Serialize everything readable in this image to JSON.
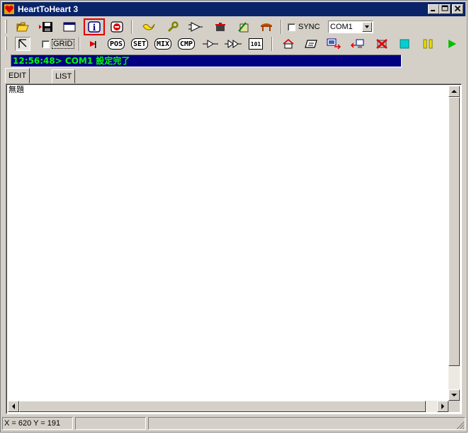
{
  "window": {
    "title": "HeartToHeart 3"
  },
  "toolbar1": {
    "sync_label": "SYNC",
    "sync_checked": false,
    "port": "COM1"
  },
  "toolbar2": {
    "grid_label": "GRID",
    "grid_checked": false,
    "text_buttons": {
      "pos": "POS",
      "set": "SET",
      "mix": "MIX",
      "cmp": "CMP",
      "io": "101"
    }
  },
  "status_message": "12:56:48> COM1 設定完了",
  "tabs": [
    {
      "label": "EDIT 無題",
      "active": true
    },
    {
      "label": "LIST",
      "active": false
    }
  ],
  "statusbar": {
    "coords": "X = 620  Y = 191",
    "pane2": "",
    "pane3": ""
  },
  "colors": {
    "title_bar": "#0a246a",
    "status_bg": "#000080",
    "status_text": "#00ff00",
    "highlight": "#e00000"
  }
}
